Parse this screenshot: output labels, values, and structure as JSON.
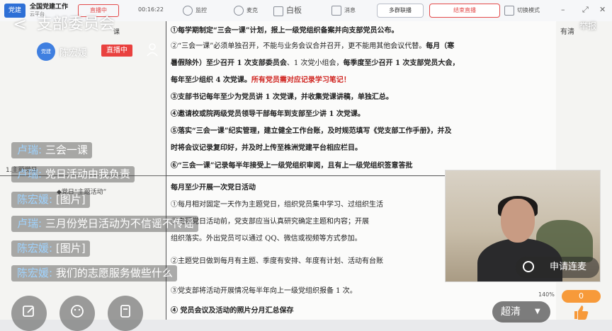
{
  "topbar": {
    "app_title": "全国党建工作",
    "app_subtitle": "云平台",
    "status_badge": "直播中",
    "timer": "00:16:22",
    "tools": [
      {
        "label": "监控",
        "icon": "camera-icon"
      },
      {
        "label": "麦克",
        "icon": "microphone-icon"
      },
      {
        "label": "白板",
        "icon": "whiteboard-icon"
      },
      {
        "label": "消息",
        "icon": "message-icon"
      }
    ],
    "multi_link_label": "多群联播",
    "end_live_label": "结束直播",
    "switch_mode_label": "切换模式"
  },
  "live_header": {
    "title": "支部委员会",
    "report_label": "举报",
    "host_name": "陈宏媛",
    "live_badge": "直播中",
    "avatar_text": "党建"
  },
  "document": {
    "left_labels": [
      "课",
      "1.主题党日",
      "◆党日“主题活动”"
    ],
    "right_label": "有清",
    "lines": [
      {
        "segments": [
          {
            "text": "①每学期制定“三会一课”计划，报上一级党组织备案并向支部党员公布。",
            "style": "bold"
          }
        ]
      },
      {
        "segments": [
          {
            "text": "②“三会一课”必须单独召开，不能与业务会议合并召开，更不能用其他会议代替。",
            "style": "normal"
          },
          {
            "text": "每月（寒",
            "style": "bold"
          }
        ]
      },
      {
        "segments": [
          {
            "text": "暑假除外）至少召开 1 次支部委员会",
            "style": "bold"
          },
          {
            "text": "、1 次党小组会，",
            "style": "normal"
          },
          {
            "text": "每季度至少召开 1 次支部党员大会，",
            "style": "bold"
          }
        ]
      },
      {
        "segments": [
          {
            "text": "每年至少组织 4 次党课。",
            "style": "bold"
          },
          {
            "text": "所有党员需对应记录学习笔记！",
            "style": "red"
          }
        ]
      },
      {
        "segments": [
          {
            "text": "③支部书记每年至少为党员讲 1 次党课，并收集党课讲稿，单独汇总。",
            "style": "bold"
          }
        ]
      },
      {
        "segments": [
          {
            "text": "④邀请校或院两级党员领导干部每年到支部至少讲 1 次党课。",
            "style": "bold"
          }
        ]
      },
      {
        "segments": [
          {
            "text": "⑤落实“三会一课”纪实管理，建立健全工作台账，及时规范填写《党支部工作手册》，并及",
            "style": "bold"
          }
        ]
      },
      {
        "segments": [
          {
            "text": "时将会议记录复印好，并及时上传至株洲党建平台相应栏目。",
            "style": "bold"
          }
        ]
      },
      {
        "segments": [
          {
            "text": "⑥“三会一课”记录每半年接受上一级党组织审阅，且有上一级党组织签意答批",
            "style": "bold"
          }
        ]
      },
      {
        "segments": [
          {
            "text": "每月至少开展一次党日活动",
            "style": "bold"
          }
        ]
      },
      {
        "segments": [
          {
            "text": "①每月相对固定一天作为主题党日，组织党员集中学习、过组织生活",
            "style": "normal"
          }
        ]
      },
      {
        "segments": [
          {
            "text": "②主题党日活动前，党支部应当认真研究确定主题和内容；开展",
            "style": "normal"
          }
        ]
      },
      {
        "segments": [
          {
            "text": "组织落实。外出党员可以通过 QQ、微信或视频等方式参加。",
            "style": "normal"
          }
        ]
      },
      {
        "segments": [
          {
            "text": "②主题党日做到每月有主题、季度有安排、年度有计划、活动有台账",
            "style": "normal"
          }
        ]
      },
      {
        "segments": [
          {
            "text": "③党支部将活动开展情况每半年向上一级党组织报备 1 次。",
            "style": "normal"
          }
        ]
      },
      {
        "segments": [
          {
            "text": "④ 党员会议及活动的照片分月汇总保存",
            "style": "bold"
          }
        ]
      }
    ]
  },
  "chat": [
    {
      "name": "卢瑞",
      "text": "三会一课"
    },
    {
      "name": "卢瑞",
      "text": "党日活动由我负责"
    },
    {
      "name": "陈宏媛",
      "text": "[图片]"
    },
    {
      "name": "卢瑞",
      "text": "三月份党日活动为不信谣不传谣"
    },
    {
      "name": "陈宏媛",
      "text": "[图片]"
    },
    {
      "name": "陈宏媛",
      "text": "我们的志愿服务做些什么"
    }
  ],
  "chat_separator": ": ",
  "controls": {
    "apply_mic_label": "申请连麦",
    "like_count": "0",
    "quality_label": "超清",
    "zoom_text": "140%"
  },
  "colors": {
    "live_red": "#e9413f",
    "doc_red": "#d0241f",
    "like_orange": "#f79a3a"
  }
}
